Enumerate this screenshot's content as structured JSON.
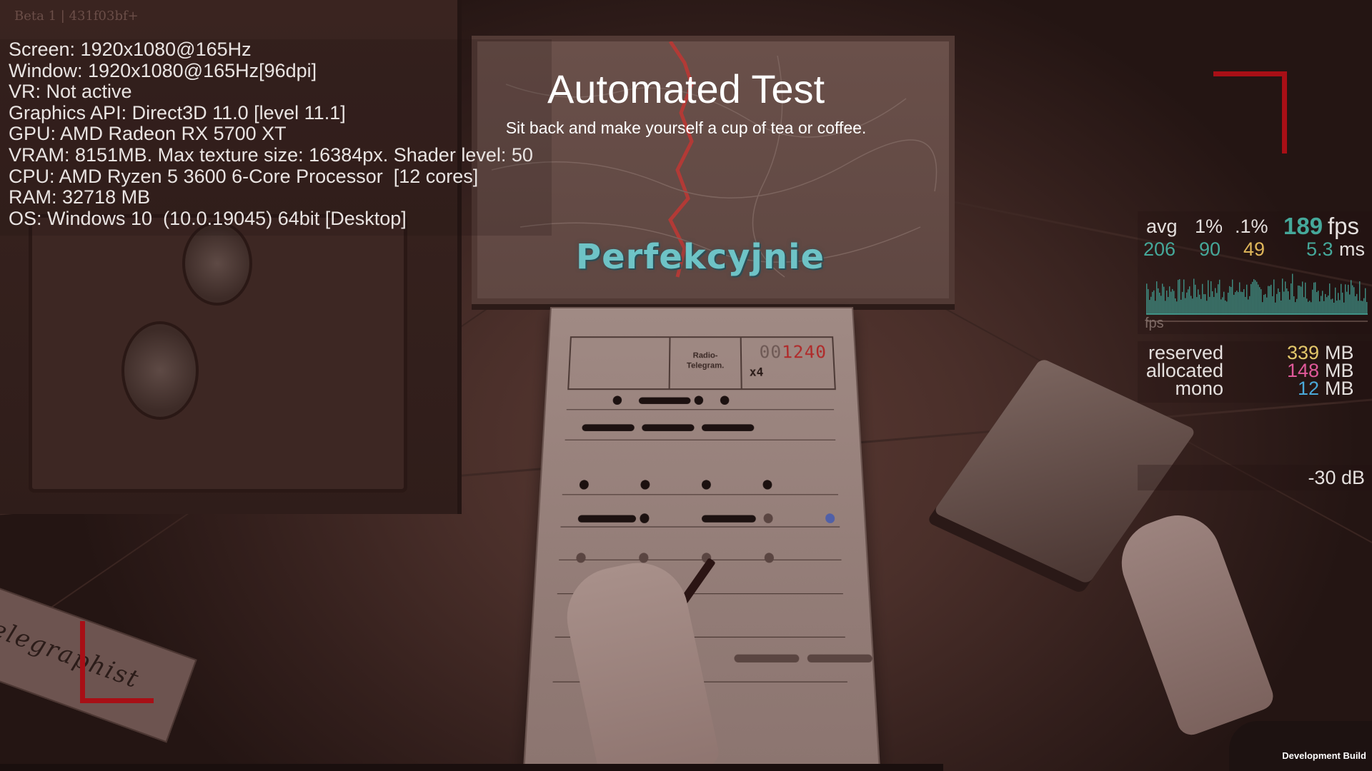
{
  "build_tag": "Beta 1 | 431f03bf+",
  "system_info": [
    "Screen: 1920x1080@165Hz",
    "Window: 1920x1080@165Hz[96dpi]",
    "VR: Not active",
    "Graphics API: Direct3D 11.0 [level 11.1]",
    "GPU: AMD Radeon RX 5700 XT",
    "VRAM: 8151MB. Max texture size: 16384px. Shader level: 50",
    "CPU: AMD Ryzen 5 3600 6-Core Processor  [12 cores]",
    "RAM: 32718 MB",
    "OS: Windows 10  (10.0.19045) 64bit [Desktop]"
  ],
  "banner": {
    "title": "Automated Test",
    "subtitle": "Sit back and make yourself a cup of tea or coffee."
  },
  "feedback": "Perfekcyjnie",
  "scene": {
    "cabinet_label": "elegraphist",
    "telegram_form": {
      "title": "Radio-\nTelegram.",
      "serial_prefix": "00",
      "serial_number": "1240",
      "multiplier": "x4"
    }
  },
  "fps_counter": {
    "headers": [
      "avg",
      "1%",
      ".1%"
    ],
    "values": [
      "206",
      "90",
      "49"
    ],
    "fps": "189",
    "fps_unit": "fps",
    "ms": "5.3",
    "ms_unit": "ms",
    "graph_label": "fps",
    "colors": {
      "avg": "#45a89a",
      "low1": "#45a89a",
      "low01": "#e0b75a",
      "fps": "#45a89a"
    }
  },
  "memory": [
    {
      "label": "reserved",
      "value": "339",
      "unit": "MB",
      "color": "#e3c76a"
    },
    {
      "label": "allocated",
      "value": "148",
      "unit": "MB",
      "color": "#e0599a"
    },
    {
      "label": "mono",
      "value": "12",
      "unit": "MB",
      "color": "#4aa8d8"
    }
  ],
  "audio_level": "-30 dB",
  "dev_build": "Development Build",
  "accent_color": "#a80f16"
}
